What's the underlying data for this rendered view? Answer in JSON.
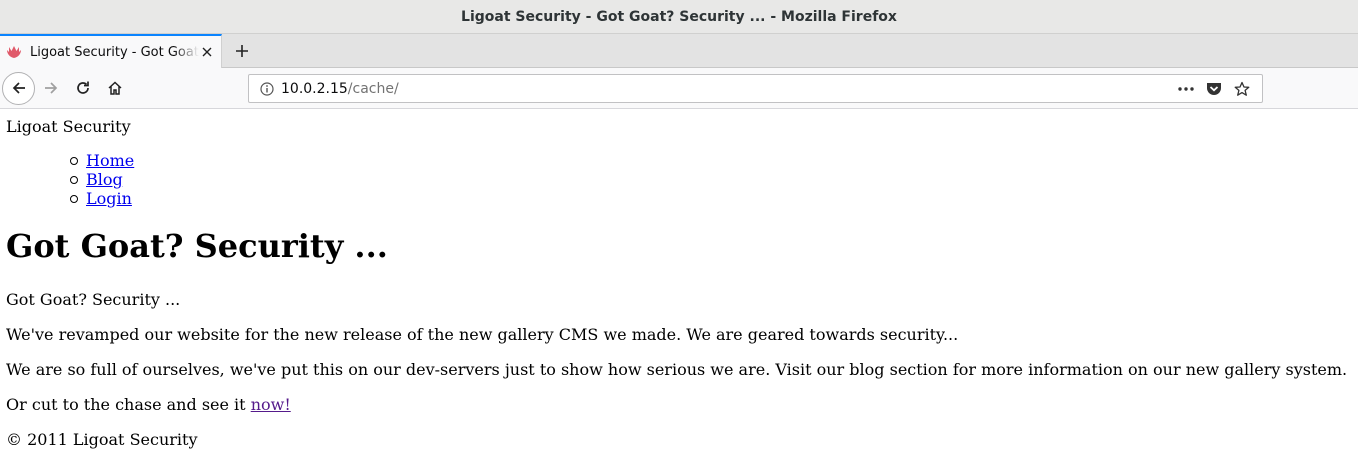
{
  "window": {
    "title": "Ligoat Security - Got Goat? Security ... - Mozilla Firefox"
  },
  "tabs": [
    {
      "title": "Ligoat Security - Got Goat? Security ...",
      "active": true
    }
  ],
  "toolbar": {
    "url_host": "10.0.2.15",
    "url_path": "/cache/"
  },
  "page": {
    "brand": "Ligoat Security",
    "menu": [
      {
        "label": "Home"
      },
      {
        "label": "Blog"
      },
      {
        "label": "Login"
      }
    ],
    "heading": "Got Goat? Security ...",
    "paragraphs": [
      "Got Goat? Security ...",
      "We've revamped our website for the new release of the new gallery CMS we made. We are geared towards security...",
      "We are so full of ourselves, we've put this on our dev-servers just to show how serious we are. Visit our blog section for more information on our new gallery system."
    ],
    "cta_text": "Or cut to the chase and see it ",
    "cta_link": "now!",
    "footer": "© 2011 Ligoat Security"
  },
  "colors": {
    "link": "#0000ee",
    "visited_link": "#551a8b",
    "tab_accent": "#0a84ff"
  }
}
